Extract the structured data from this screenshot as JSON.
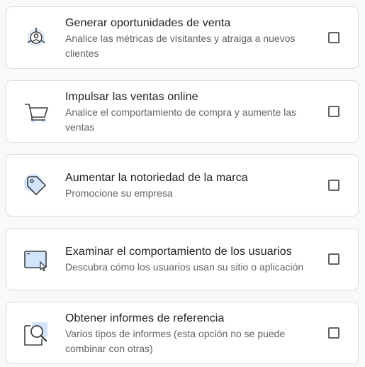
{
  "objectives": [
    {
      "title": "Generar oportunidades de venta",
      "description": "Analice las métricas de visitantes y atraiga a nuevos clientes",
      "icon": "leads-icon",
      "checked": false
    },
    {
      "title": "Impulsar las ventas online",
      "description": "Analice el comportamiento de compra y aumente las ventas",
      "icon": "shopping-cart-icon",
      "checked": false
    },
    {
      "title": "Aumentar la notoriedad de la marca",
      "description": "Promocione su empresa",
      "icon": "tag-icon",
      "checked": false
    },
    {
      "title": "Examinar el comportamiento de los usuarios",
      "description": "Descubra cómo los usuarios usan su sitio o aplicación",
      "icon": "browser-cursor-icon",
      "checked": false
    },
    {
      "title": "Obtener informes de referencia",
      "description": "Varios tipos de informes (esta opción no se puede combinar con otras)",
      "icon": "report-magnifier-icon",
      "checked": false
    }
  ],
  "colors": {
    "accent_light": "#d2e3fc",
    "accent": "#1a73e8",
    "icon_stroke": "#3c4043",
    "title_text": "#202124",
    "desc_text": "#5f6368",
    "card_border": "#dadce0"
  }
}
